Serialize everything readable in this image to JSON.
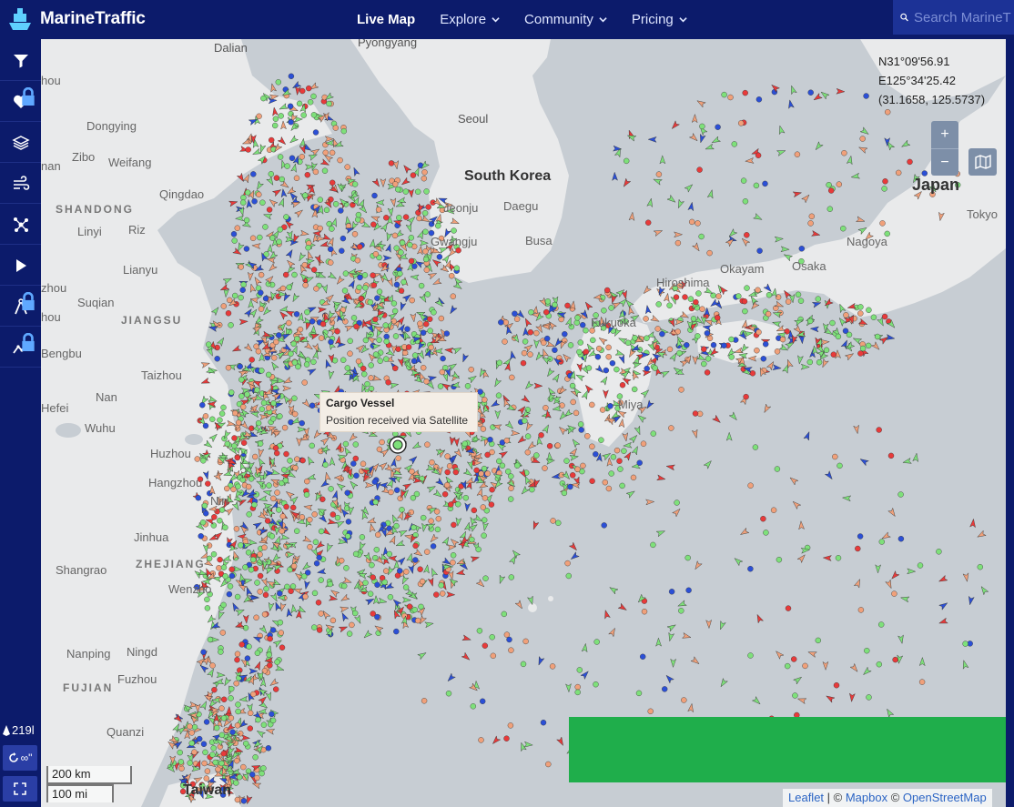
{
  "app": {
    "logo_text": "MarineTraffic",
    "brand_color": "#0c1b6b",
    "accent_color": "#1c3296"
  },
  "nav": {
    "items": [
      {
        "label": "Live Map",
        "active": true,
        "has_dropdown": false
      },
      {
        "label": "Explore",
        "active": false,
        "has_dropdown": true
      },
      {
        "label": "Community",
        "active": false,
        "has_dropdown": true
      },
      {
        "label": "Pricing",
        "active": false,
        "has_dropdown": true
      }
    ]
  },
  "search": {
    "placeholder": "Search MarineT",
    "icon": "search-icon"
  },
  "sidebar": {
    "items": [
      {
        "icon": "filter-icon",
        "locked": false
      },
      {
        "icon": "heart-icon",
        "locked": true
      },
      {
        "icon": "layers-icon",
        "locked": false
      },
      {
        "icon": "wind-icon",
        "locked": false
      },
      {
        "icon": "network-icon",
        "locked": false
      },
      {
        "icon": "play-icon",
        "locked": false
      },
      {
        "icon": "compass-icon",
        "locked": true
      },
      {
        "icon": "graph-icon",
        "locked": true
      }
    ],
    "vessel_count": "219l",
    "bottom_buttons": [
      {
        "icon": "infinity-icon",
        "label": "∞\""
      },
      {
        "icon": "fullscreen-icon",
        "label": ""
      }
    ]
  },
  "map": {
    "coords": {
      "lat": "N31°09'56.91",
      "lon": "E125°34'25.42",
      "decimal": "(31.1658, 125.5737)"
    },
    "zoom": {
      "in": "+",
      "out": "−"
    },
    "popup": {
      "title": "Cargo Vessel",
      "subtitle": "Position received via Satellite"
    },
    "scale": {
      "km": "200 km",
      "mi": "100 mi"
    },
    "attribution": {
      "leaflet": "Leaflet",
      "sep": " | © ",
      "mapbox": "Mapbox",
      "sep2": " © ",
      "osm": "OpenStreetMap"
    },
    "labels": {
      "pyongyang": "Pyongyang",
      "dalian": "Dalian",
      "seoul": "Seoul",
      "south_korea": "South Korea",
      "daegu": "Daegu",
      "jeonju": "Jeonju",
      "gwangju": "Gwangju",
      "busan": "Busa",
      "japan": "Japan",
      "tokyo": "Tokyo",
      "nagoya": "Nagoya",
      "osaka": "Osaka",
      "okayama": "Okayam",
      "hiroshima": "Hiroshima",
      "miyazaki": "Miya",
      "fukuoka": "Fukuoka",
      "dongying": "Dongying",
      "zibo": "Zibo",
      "weifang": "Weifang",
      "qingdao": "Qingdao",
      "shandong": "SHANDONG",
      "linyi": "Linyi",
      "lianyungang": "Lianyu",
      "suqian": "Suqian",
      "xuzhou": "zhou",
      "jiangsu": "JIANGSU",
      "bengbu": "Bengbu",
      "taizhou": "Taizhou",
      "hefei": "Hefei",
      "nanjing": "Nan",
      "wuhu": "Wuhu",
      "huzhou": "Huzhou",
      "hangzhou": "Hangzhou",
      "ningbo": "Nin",
      "jinhua": "Jinhua",
      "zhejiang": "ZHEJIANG",
      "shangrao": "Shangrao",
      "wenzhou": "Wenzho",
      "nanping": "Nanping",
      "ningde": "Ningd",
      "fujian": "FUJIAN",
      "fuzhou": "Fuzhou",
      "quanzhou": "Quanzi",
      "taiwan": "Taiwan",
      "chou": "hou",
      "nan": "nan",
      "rizhao": "Riz"
    }
  },
  "colors": {
    "water": "#c7cdd3",
    "land": "#e9eaeb",
    "cargo": "#7ee07a",
    "tanker": "#e83a3a",
    "passenger": "#2b4fd6",
    "fishing": "#f0a07a",
    "ad_banner": "#1fae4b"
  }
}
